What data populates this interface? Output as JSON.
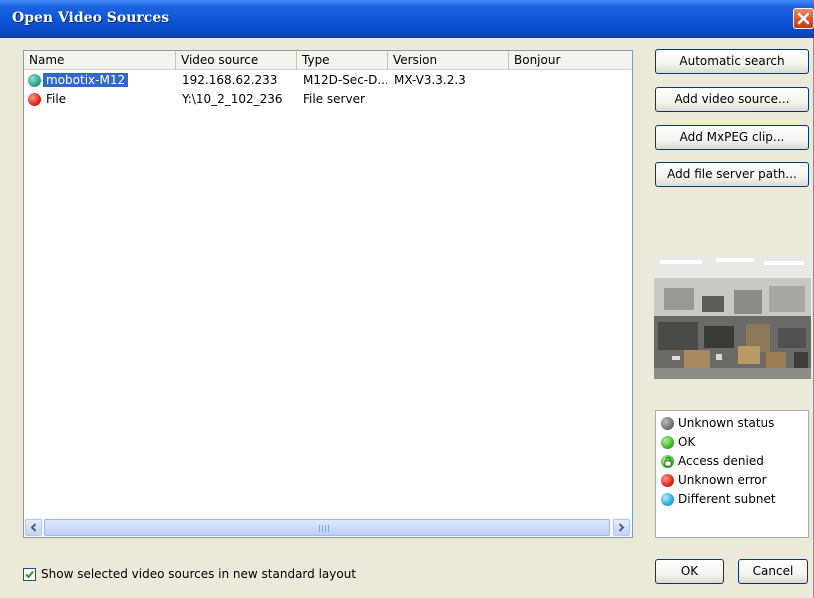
{
  "window": {
    "title": "Open Video Sources"
  },
  "table": {
    "columns": [
      "Name",
      "Video source",
      "Type",
      "Version",
      "Bonjour"
    ],
    "rows": [
      {
        "name": "mobotix-M12",
        "video_source": "192.168.62.233",
        "type": "M12D-Sec-D...",
        "version": "MX-V3.3.2.3",
        "bonjour": "",
        "status": "teal",
        "selected": true
      },
      {
        "name": "File",
        "video_source": "Y:\\10_2_102_236",
        "type": "File server",
        "version": "",
        "bonjour": "",
        "status": "red",
        "selected": false
      }
    ]
  },
  "buttons": {
    "automatic_search": "Automatic search",
    "add_video_source": "Add video source...",
    "add_mxpeg_clip": "Add MxPEG clip...",
    "add_file_server_path": "Add file server path...",
    "ok": "OK",
    "cancel": "Cancel"
  },
  "legend": [
    {
      "label": "Unknown status",
      "color": "gray"
    },
    {
      "label": "OK",
      "color": "green"
    },
    {
      "label": "Access denied",
      "color": "green-lock"
    },
    {
      "label": "Unknown error",
      "color": "red"
    },
    {
      "label": "Different subnet",
      "color": "blue"
    }
  ],
  "footer": {
    "checkbox_checked": true,
    "checkbox_label": "Show selected video sources in new standard layout"
  },
  "colors": {
    "titlebar": "#0b54d6",
    "selection": "#316ac5",
    "dialog_bg": "#ece9d8"
  }
}
